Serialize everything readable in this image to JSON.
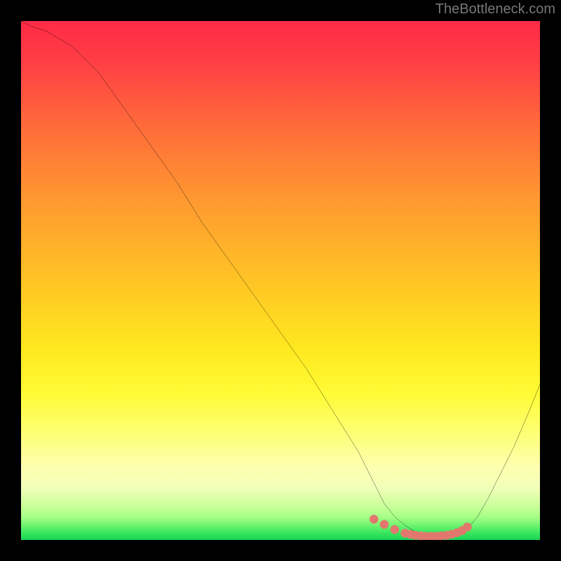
{
  "watermark": "TheBottleneck.com",
  "chart_data": {
    "type": "line",
    "title": "",
    "xlabel": "",
    "ylabel": "",
    "xlim": [
      0,
      100
    ],
    "ylim": [
      0,
      100
    ],
    "series": [
      {
        "name": "curve",
        "x": [
          0,
          2,
          5,
          10,
          15,
          20,
          25,
          30,
          35,
          40,
          45,
          50,
          55,
          60,
          65,
          68,
          70,
          72,
          74,
          76,
          78,
          80,
          82,
          84,
          86,
          88,
          90,
          92,
          95,
          98,
          100
        ],
        "y": [
          100,
          99,
          98,
          95,
          90,
          83,
          76,
          69,
          61,
          54,
          47,
          40,
          33,
          25,
          17,
          11,
          7,
          4.5,
          2.8,
          1.6,
          0.9,
          0.5,
          0.6,
          1.0,
          2.2,
          4.5,
          8,
          12,
          18,
          25,
          30
        ]
      },
      {
        "name": "highlight-dots",
        "x": [
          68,
          70,
          72,
          74,
          75,
          76,
          77,
          78,
          79,
          80,
          81,
          82,
          83,
          84,
          85,
          86
        ],
        "y": [
          4.0,
          3.0,
          2.0,
          1.3,
          1.1,
          0.9,
          0.8,
          0.7,
          0.7,
          0.7,
          0.8,
          0.9,
          1.1,
          1.4,
          1.8,
          2.5
        ]
      }
    ],
    "gradient_stops": [
      {
        "pos": 0,
        "color": "#ff2a47"
      },
      {
        "pos": 8,
        "color": "#ff3f45"
      },
      {
        "pos": 20,
        "color": "#ff6a3a"
      },
      {
        "pos": 35,
        "color": "#ff9a30"
      },
      {
        "pos": 50,
        "color": "#ffc425"
      },
      {
        "pos": 63,
        "color": "#ffe81f"
      },
      {
        "pos": 72,
        "color": "#fffb36"
      },
      {
        "pos": 80,
        "color": "#fdff7a"
      },
      {
        "pos": 86,
        "color": "#feffb0"
      },
      {
        "pos": 90,
        "color": "#f1ffb8"
      },
      {
        "pos": 93,
        "color": "#d0ff9f"
      },
      {
        "pos": 95.5,
        "color": "#a8ff87"
      },
      {
        "pos": 97,
        "color": "#76f573"
      },
      {
        "pos": 98.5,
        "color": "#3de85f"
      },
      {
        "pos": 100,
        "color": "#18d455"
      }
    ],
    "highlight_color": "#e2786d",
    "curve_color": "#000000"
  }
}
